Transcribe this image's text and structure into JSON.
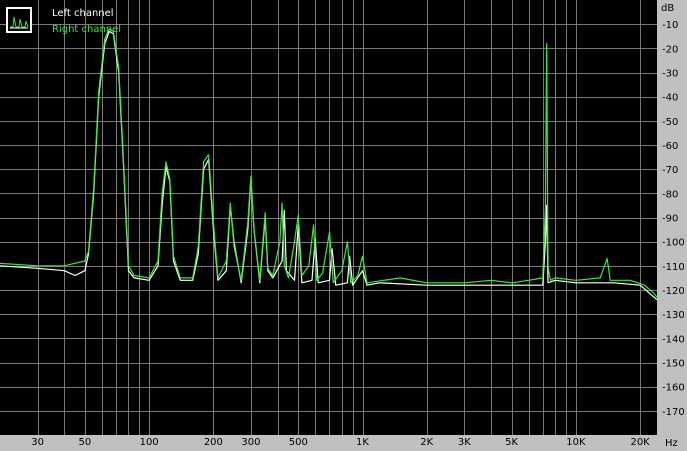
{
  "colors": {
    "background": "#c0c0c0",
    "plot": "#000000",
    "grid": "#7a7a7a",
    "left": "#ffffff",
    "right": "#33ee33"
  },
  "legend": {
    "left": "Left channel",
    "right": "Right channel"
  },
  "chart_data": {
    "type": "line",
    "xscale": "log",
    "xlabel": "Hz",
    "ylabel": "dB",
    "xlim": [
      20,
      24000
    ],
    "ylim": [
      -180,
      0
    ],
    "grid": true,
    "legend_position": "top-left",
    "x_ticks": [
      {
        "value": 30,
        "label": "30"
      },
      {
        "value": 50,
        "label": "50"
      },
      {
        "value": 100,
        "label": "100"
      },
      {
        "value": 200,
        "label": "200"
      },
      {
        "value": 300,
        "label": "300"
      },
      {
        "value": 500,
        "label": "500"
      },
      {
        "value": 1000,
        "label": "1K"
      },
      {
        "value": 2000,
        "label": "2K"
      },
      {
        "value": 3000,
        "label": "3K"
      },
      {
        "value": 5000,
        "label": "5K"
      },
      {
        "value": 10000,
        "label": "10K"
      },
      {
        "value": 20000,
        "label": "20K"
      }
    ],
    "y_ticks": [
      -10,
      -20,
      -30,
      -40,
      -50,
      -60,
      -70,
      -80,
      -90,
      -100,
      -110,
      -120,
      -130,
      -140,
      -150,
      -160,
      -170
    ],
    "series": [
      {
        "name": "Left channel",
        "color": "#ffffff",
        "points": [
          [
            20,
            -110
          ],
          [
            30,
            -111
          ],
          [
            40,
            -112
          ],
          [
            45,
            -114
          ],
          [
            50,
            -112
          ],
          [
            52,
            -105
          ],
          [
            55,
            -80
          ],
          [
            58,
            -40
          ],
          [
            62,
            -18
          ],
          [
            65,
            -13
          ],
          [
            68,
            -14
          ],
          [
            72,
            -30
          ],
          [
            76,
            -70
          ],
          [
            80,
            -112
          ],
          [
            85,
            -115
          ],
          [
            100,
            -116
          ],
          [
            110,
            -110
          ],
          [
            115,
            -85
          ],
          [
            120,
            -69
          ],
          [
            125,
            -75
          ],
          [
            130,
            -108
          ],
          [
            140,
            -116
          ],
          [
            160,
            -116
          ],
          [
            170,
            -105
          ],
          [
            180,
            -70
          ],
          [
            190,
            -66
          ],
          [
            200,
            -95
          ],
          [
            210,
            -116
          ],
          [
            230,
            -112
          ],
          [
            240,
            -85
          ],
          [
            250,
            -100
          ],
          [
            270,
            -117
          ],
          [
            290,
            -95
          ],
          [
            300,
            -74
          ],
          [
            310,
            -95
          ],
          [
            330,
            -117
          ],
          [
            350,
            -90
          ],
          [
            360,
            -112
          ],
          [
            380,
            -115
          ],
          [
            420,
            -108
          ],
          [
            430,
            -87
          ],
          [
            440,
            -112
          ],
          [
            480,
            -116
          ],
          [
            500,
            -93
          ],
          [
            520,
            -117
          ],
          [
            580,
            -116
          ],
          [
            600,
            -99
          ],
          [
            620,
            -117
          ],
          [
            700,
            -116
          ],
          [
            720,
            -103
          ],
          [
            750,
            -118
          ],
          [
            850,
            -117
          ],
          [
            870,
            -106
          ],
          [
            900,
            -118
          ],
          [
            1000,
            -112
          ],
          [
            1050,
            -118
          ],
          [
            1200,
            -117
          ],
          [
            2000,
            -118
          ],
          [
            4000,
            -118
          ],
          [
            7000,
            -118
          ],
          [
            7200,
            -100
          ],
          [
            7300,
            -85
          ],
          [
            7400,
            -117
          ],
          [
            8000,
            -116
          ],
          [
            10000,
            -117
          ],
          [
            15000,
            -117
          ],
          [
            20000,
            -118
          ],
          [
            24000,
            -124
          ]
        ]
      },
      {
        "name": "Right channel",
        "color": "#33ee33",
        "points": [
          [
            20,
            -109
          ],
          [
            30,
            -110
          ],
          [
            40,
            -110
          ],
          [
            50,
            -108
          ],
          [
            52,
            -104
          ],
          [
            55,
            -78
          ],
          [
            58,
            -38
          ],
          [
            62,
            -16
          ],
          [
            65,
            -12
          ],
          [
            68,
            -13
          ],
          [
            72,
            -28
          ],
          [
            76,
            -68
          ],
          [
            80,
            -110
          ],
          [
            85,
            -114
          ],
          [
            100,
            -115
          ],
          [
            110,
            -108
          ],
          [
            115,
            -80
          ],
          [
            120,
            -67
          ],
          [
            125,
            -74
          ],
          [
            130,
            -106
          ],
          [
            140,
            -115
          ],
          [
            160,
            -115
          ],
          [
            170,
            -102
          ],
          [
            180,
            -67
          ],
          [
            190,
            -64
          ],
          [
            200,
            -92
          ],
          [
            210,
            -115
          ],
          [
            230,
            -108
          ],
          [
            240,
            -84
          ],
          [
            250,
            -102
          ],
          [
            270,
            -116
          ],
          [
            290,
            -92
          ],
          [
            300,
            -73
          ],
          [
            310,
            -95
          ],
          [
            330,
            -116
          ],
          [
            350,
            -88
          ],
          [
            360,
            -111
          ],
          [
            380,
            -114
          ],
          [
            410,
            -100
          ],
          [
            420,
            -84
          ],
          [
            430,
            -110
          ],
          [
            450,
            -115
          ],
          [
            480,
            -100
          ],
          [
            500,
            -89
          ],
          [
            520,
            -114
          ],
          [
            560,
            -110
          ],
          [
            590,
            -93
          ],
          [
            610,
            -116
          ],
          [
            650,
            -113
          ],
          [
            700,
            -96
          ],
          [
            730,
            -117
          ],
          [
            800,
            -112
          ],
          [
            850,
            -100
          ],
          [
            880,
            -117
          ],
          [
            950,
            -114
          ],
          [
            1000,
            -106
          ],
          [
            1050,
            -117
          ],
          [
            1500,
            -115
          ],
          [
            2000,
            -117
          ],
          [
            3000,
            -117
          ],
          [
            4000,
            -116
          ],
          [
            5000,
            -117
          ],
          [
            6000,
            -116
          ],
          [
            7000,
            -115
          ],
          [
            7100,
            -100
          ],
          [
            7200,
            -86
          ],
          [
            7300,
            -18
          ],
          [
            7400,
            -110
          ],
          [
            7600,
            -116
          ],
          [
            8000,
            -115
          ],
          [
            10000,
            -116
          ],
          [
            13000,
            -115
          ],
          [
            14000,
            -107
          ],
          [
            14500,
            -116
          ],
          [
            18000,
            -116
          ],
          [
            21000,
            -118
          ],
          [
            23000,
            -121
          ],
          [
            24000,
            -123
          ]
        ]
      }
    ]
  }
}
